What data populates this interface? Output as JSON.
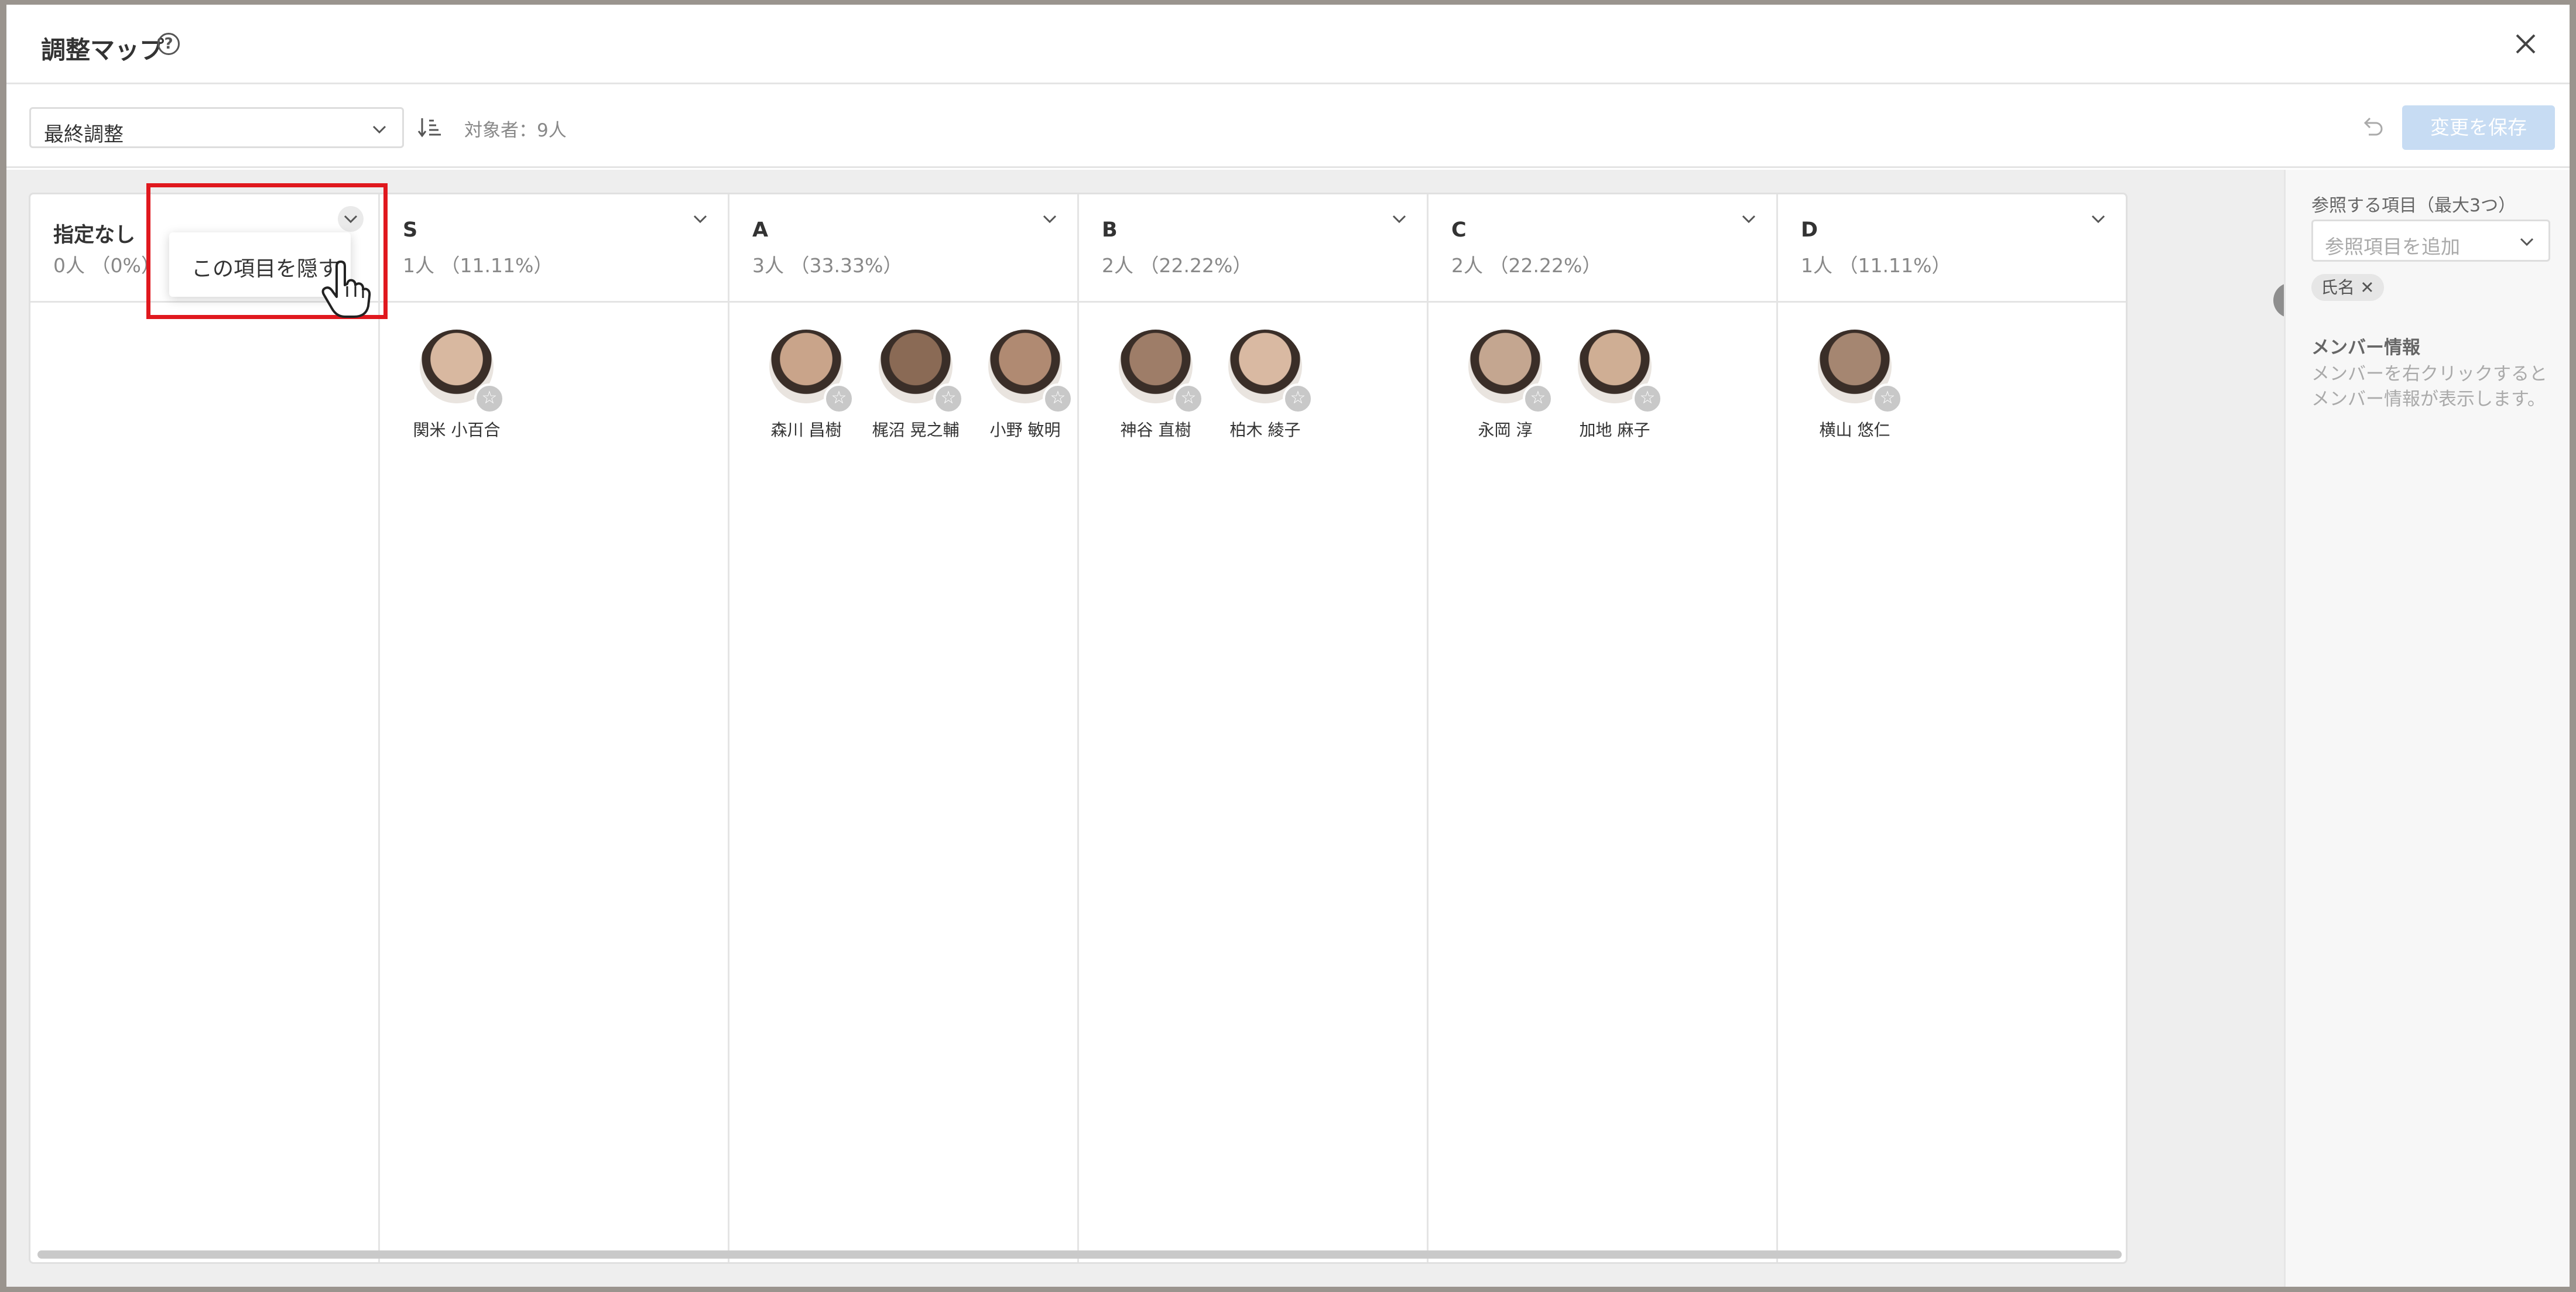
{
  "modal": {
    "title": "調整マップ",
    "help_icon": "question-circle-icon",
    "close_icon": "close-icon"
  },
  "toolbar": {
    "select_value": "最終調整",
    "sort_icon": "sort-icon",
    "target_count": "対象者：9人",
    "undo_icon": "undo-icon",
    "save_label": "変更を保存"
  },
  "columns": [
    {
      "title": "指定なし",
      "count": "0人 （0%）",
      "members": []
    },
    {
      "title": "S",
      "count": "1人 （11.11%）",
      "members": [
        {
          "name": "関米 小百合",
          "avatar_color": "#d8b8a0"
        }
      ]
    },
    {
      "title": "A",
      "count": "3人 （33.33%）",
      "members": [
        {
          "name": "森川 昌樹",
          "avatar_color": "#c9a48a"
        },
        {
          "name": "梶沼 晃之輔",
          "avatar_color": "#8a6a55"
        },
        {
          "name": "小野 敏明",
          "avatar_color": "#b08a72"
        }
      ]
    },
    {
      "title": "B",
      "count": "2人 （22.22%）",
      "members": [
        {
          "name": "神谷 直樹",
          "avatar_color": "#9e7d68"
        },
        {
          "name": "柏木 綾子",
          "avatar_color": "#d9b9a2"
        }
      ]
    },
    {
      "title": "C",
      "count": "2人 （22.22%）",
      "members": [
        {
          "name": "永岡 淳",
          "avatar_color": "#c4a690"
        },
        {
          "name": "加地 麻子",
          "avatar_color": "#cfae94"
        }
      ]
    },
    {
      "title": "D",
      "count": "1人 （11.11%）",
      "members": [
        {
          "name": "横山 悠仁",
          "avatar_color": "#a58671"
        }
      ]
    }
  ],
  "popup": {
    "label": "この項目を隠す"
  },
  "side_panel": {
    "ref_label": "参照する項目（最大3つ）",
    "ref_placeholder": "参照項目を追加",
    "tag": "氏名 ✕",
    "section_title": "メンバー情報",
    "section_desc": "メンバーを右クリックするとメンバー情報が表示します。"
  },
  "colors": {
    "highlight": "#e0181e",
    "save_button": "#c7dcf3"
  }
}
